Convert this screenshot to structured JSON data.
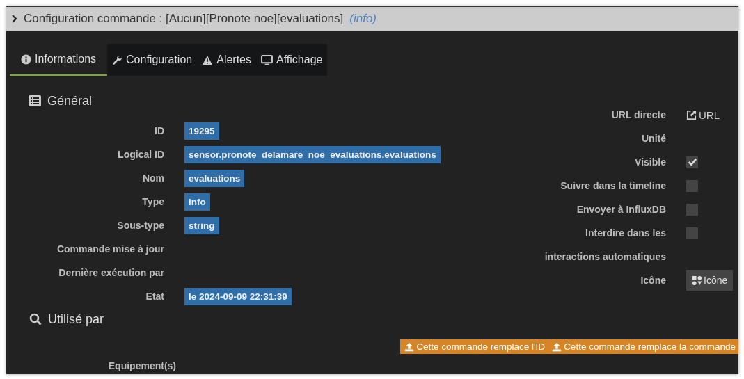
{
  "header": {
    "title": "Configuration commande : [Aucun][Pronote noe][evaluations]",
    "type_link": "(info)"
  },
  "tabs": [
    {
      "label": "Informations",
      "kind": "info",
      "selected": true
    },
    {
      "label": "Configuration",
      "kind": "wrench",
      "selected": false
    },
    {
      "label": "Alertes",
      "kind": "warning",
      "selected": false
    },
    {
      "label": "Affichage",
      "kind": "monitor",
      "selected": false
    }
  ],
  "general": {
    "title": "Général",
    "fields": [
      {
        "label": "ID",
        "value": "19295"
      },
      {
        "label": "Logical ID",
        "value": "sensor.pronote_delamare_noe_evaluations.evaluations"
      },
      {
        "label": "Nom",
        "value": "evaluations"
      },
      {
        "label": "Type",
        "value": "info"
      },
      {
        "label": "Sous-type",
        "value": "string"
      },
      {
        "label": "Commande mise à jour"
      },
      {
        "label": "Dernière exécution par"
      },
      {
        "label": "Etat",
        "value": "le 2024-09-09 22:31:39"
      }
    ]
  },
  "options": [
    {
      "kind": "link",
      "label": "URL directe",
      "value": "URL"
    },
    {
      "kind": "text",
      "label": "Unité"
    },
    {
      "kind": "checkbox",
      "label": "Visible",
      "checked": true
    },
    {
      "kind": "checkbox",
      "label": "Suivre dans la timeline",
      "checked": false
    },
    {
      "kind": "checkbox",
      "label": "Envoyer à InfluxDB",
      "checked": false
    },
    {
      "kind": "checkbox",
      "label": "Interdire dans les",
      "checked": false
    },
    {
      "kind": "text",
      "label": "interactions automatiques"
    },
    {
      "kind": "button",
      "label": "Icône",
      "value": "Icône"
    }
  ],
  "used_by": {
    "title": "Utilisé par",
    "actions": [
      "Cette commande remplace l'ID",
      "Cette commande remplace la commande"
    ],
    "fields": [
      {
        "label": "Equipement(s)"
      }
    ]
  }
}
